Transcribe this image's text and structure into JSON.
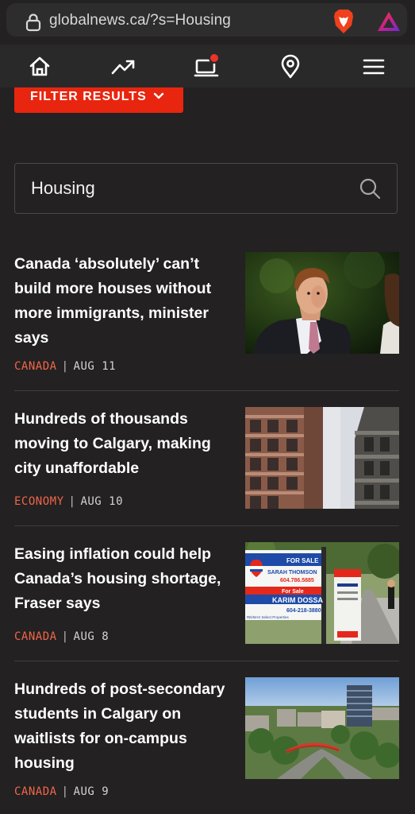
{
  "browser": {
    "url": "globalnews.ca/?s=Housing"
  },
  "nav": {
    "items": [
      "home-icon",
      "trending-icon",
      "watch-icon",
      "location-icon",
      "menu-icon"
    ]
  },
  "filter": {
    "label": "FILTER RESULTS"
  },
  "search": {
    "value": "Housing"
  },
  "colors": {
    "accent": "#e8250f",
    "category": "#f0664a",
    "background": "#232121"
  },
  "articles": [
    {
      "title": "Canada ‘absolutely’ can’t build more houses without more immigrants, minister says",
      "category": "CANADA",
      "date": "AUG 11"
    },
    {
      "title": "Hundreds of thousands moving to Calgary, making city unaffordable",
      "category": "ECONOMY",
      "date": "AUG 10"
    },
    {
      "title": "Easing inflation could help Canada’s housing shortage, Fraser says",
      "category": "CANADA",
      "date": "AUG 8",
      "sign_text": {
        "for_sale": "FOR SALE",
        "name1": "SARAH THOMSON",
        "phone1": "604.786.5885",
        "for_sale_2": "For Sale",
        "name2": "KARIM DOSSA",
        "phone2": "604-218-3880",
        "brokerage": "RE/MAX Select Properties"
      }
    },
    {
      "title": "Hundreds of post-secondary students in Calgary on waitlists for on-campus housing",
      "category": "CANADA",
      "date": "AUG 9"
    }
  ]
}
